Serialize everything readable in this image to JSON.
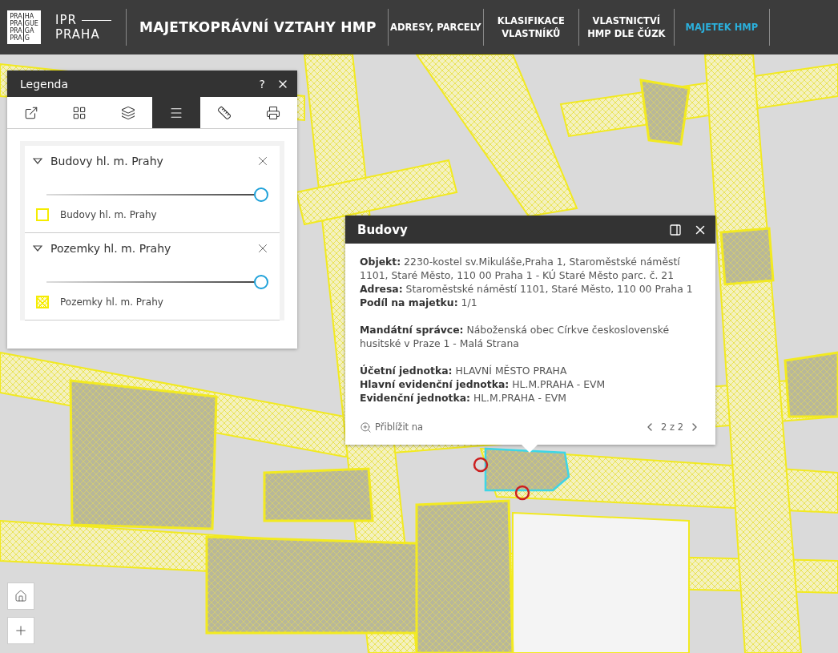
{
  "header": {
    "logo_mark": [
      [
        "PRA",
        "HA"
      ],
      [
        "PRA",
        "GUE"
      ],
      [
        "PRA",
        "GA"
      ],
      [
        "PRA",
        "G"
      ]
    ],
    "logo_top": "IPR",
    "logo_bottom": "PRAHA",
    "title": "MAJETKOPRÁVNÍ VZTAHY HMP",
    "nav": [
      {
        "label": "ADRESY, PARCELY",
        "selected": false
      },
      {
        "label": "KLASIFIKACE VLASTNÍKŮ",
        "selected": false
      },
      {
        "label": "VLASTNICTVÍ HMP DLE ČÚZK",
        "selected": false
      },
      {
        "label": "MAJETEK HMP",
        "selected": true
      }
    ]
  },
  "legend": {
    "title": "Legenda",
    "help": "?",
    "tools": [
      {
        "kind": "share",
        "selected": false
      },
      {
        "kind": "basemap",
        "selected": false
      },
      {
        "kind": "layers",
        "selected": false
      },
      {
        "kind": "legend",
        "selected": true
      },
      {
        "kind": "measure",
        "selected": false
      },
      {
        "kind": "print",
        "selected": false
      }
    ],
    "layers": [
      {
        "name": "Budovy hl. m. Prahy",
        "expanded": true,
        "level": 1,
        "kind": "outline",
        "item": "Budovy hl. m. Prahy"
      },
      {
        "name": "Pozemky hl. m. Prahy",
        "expanded": true,
        "level": 1,
        "kind": "hatched",
        "item": "Pozemky hl. m. Prahy"
      }
    ]
  },
  "popup": {
    "title": "Budovy",
    "sections": [
      [
        "**Objekt:** 2230-kostel sv.Mikuláše,Praha 1, Staroměstské náměstí 1101, Staré Město, 110 00 Praha 1 - KÚ Staré Město parc. č. 21",
        "**Adresa:** Staroměstské náměstí 1101, Staré Město, 110 00 Praha 1",
        "**Podíl na majetku:** 1/1"
      ],
      [
        "**Mandátní správce:** Náboženská obec Církve československé husitské v Praze 1 - Malá Strana"
      ],
      [
        "**Účetní jednotka:** HLAVNÍ MĚSTO PRAHA",
        "**Hlavní evidenční jednotka:** HL.M.PRAHA - EVM",
        "**Evidenční jednotka:** HL.M.PRAHA - EVM"
      ]
    ],
    "zoom_link": "Přiblížit na",
    "pager": "2 z 2"
  }
}
